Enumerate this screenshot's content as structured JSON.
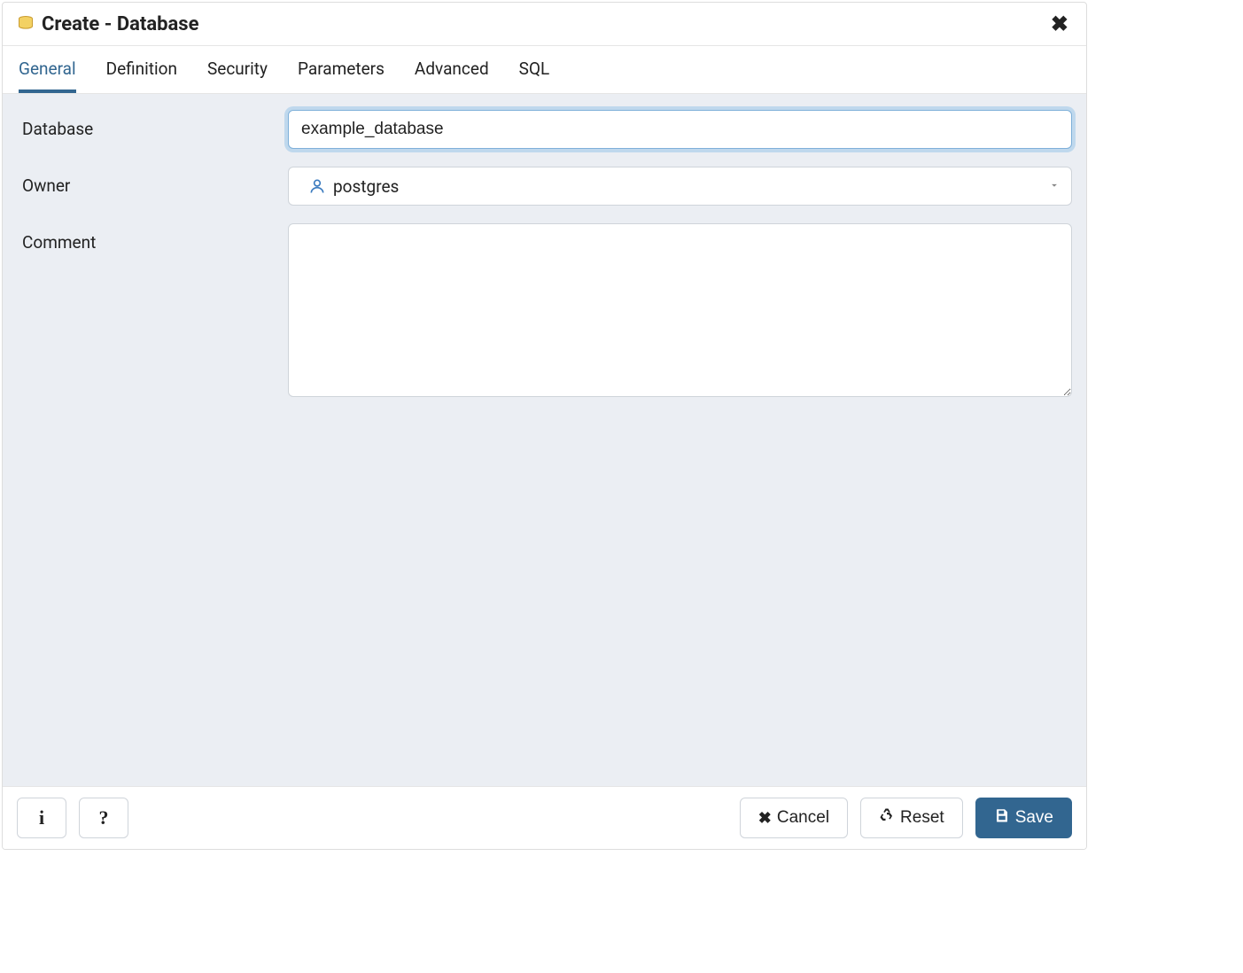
{
  "header": {
    "title": "Create - Database"
  },
  "tabs": [
    {
      "label": "General",
      "active": true
    },
    {
      "label": "Definition",
      "active": false
    },
    {
      "label": "Security",
      "active": false
    },
    {
      "label": "Parameters",
      "active": false
    },
    {
      "label": "Advanced",
      "active": false
    },
    {
      "label": "SQL",
      "active": false
    }
  ],
  "form": {
    "database_label": "Database",
    "database_value": "example_database",
    "owner_label": "Owner",
    "owner_value": "postgres",
    "comment_label": "Comment",
    "comment_value": ""
  },
  "footer": {
    "cancel_label": "Cancel",
    "reset_label": "Reset",
    "save_label": "Save"
  }
}
